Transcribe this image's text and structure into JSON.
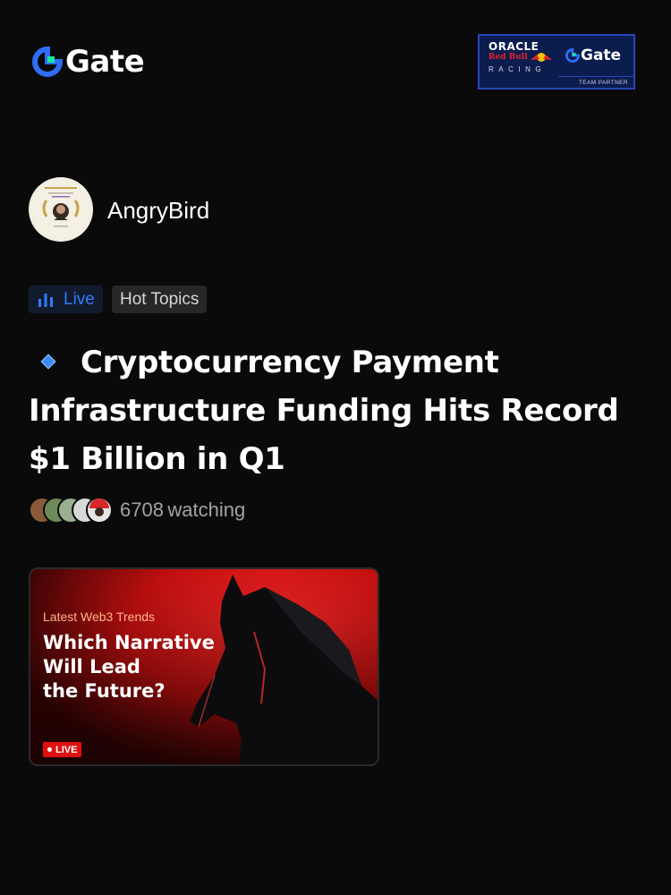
{
  "brand": {
    "name": "Gate"
  },
  "partner_badge": {
    "line1": "ORACLE",
    "line2": "Red Bull",
    "line3": "RACING",
    "brand": "Gate",
    "caption": "TEAM PARTNER"
  },
  "author": {
    "username": "AngryBird"
  },
  "tags": {
    "live": "Live",
    "topic": "Hot Topics"
  },
  "post": {
    "headline": "Cryptocurrency Payment Infrastructure Funding Hits Record $1 Billion in Q1",
    "watching_count": "6708",
    "watching_suffix": "watching"
  },
  "video_card": {
    "kicker": "Latest Web3 Trends",
    "title": "Which Narrative\nWill Lead\nthe Future?",
    "live_badge": "LIVE"
  },
  "colors": {
    "background": "#0a0a0a",
    "accent_blue": "#2f7df6",
    "brand_green": "#17e6a1",
    "live_red": "#e01010"
  }
}
